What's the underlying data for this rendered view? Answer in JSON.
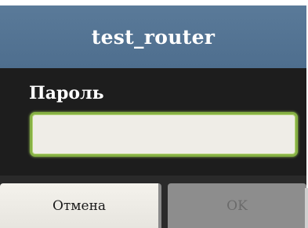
{
  "dialog": {
    "title": "test_router",
    "password_label": "Пароль",
    "password_value": "",
    "password_placeholder": ""
  },
  "buttons": {
    "cancel_label": "Отмена",
    "ok_label": "OK"
  },
  "colors": {
    "title_bar": "#526f8e",
    "body_background": "#1d1d1d",
    "input_border_focus": "#86b144",
    "input_fill": "#efede7",
    "cancel_button": "#ecebe5",
    "ok_button_disabled": "#8d8d8d"
  }
}
